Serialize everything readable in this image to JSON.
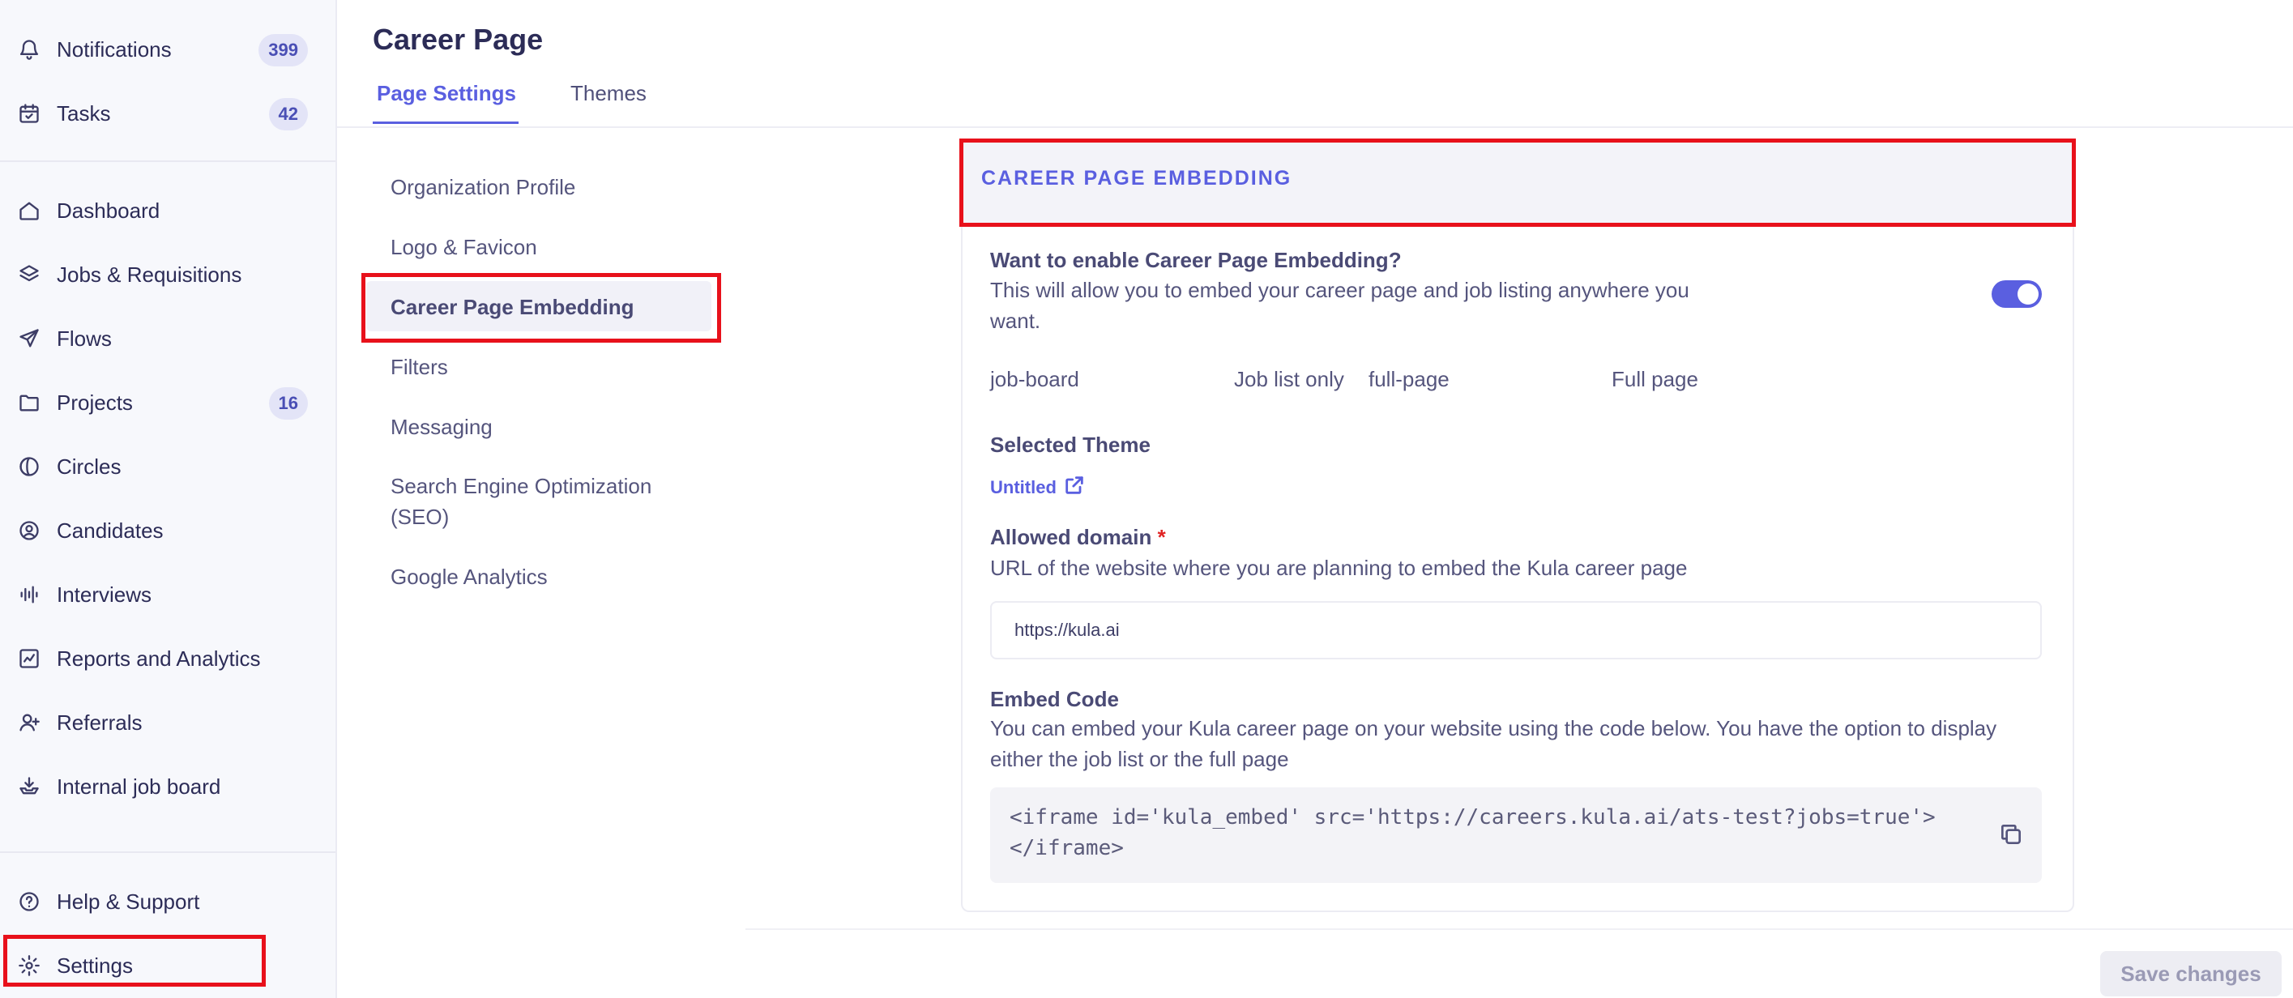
{
  "sidebar": {
    "top_items": [
      {
        "label": "Notifications",
        "icon": "bell-icon",
        "badge": "399"
      },
      {
        "label": "Tasks",
        "icon": "calendar-check-icon",
        "badge": "42"
      }
    ],
    "main_items": [
      {
        "label": "Dashboard",
        "icon": "home-icon"
      },
      {
        "label": "Jobs & Requisitions",
        "icon": "layers-icon"
      },
      {
        "label": "Flows",
        "icon": "send-icon"
      },
      {
        "label": "Projects",
        "icon": "folder-icon",
        "badge": "16"
      },
      {
        "label": "Circles",
        "icon": "circle-half-icon"
      },
      {
        "label": "Candidates",
        "icon": "user-circle-icon"
      },
      {
        "label": "Interviews",
        "icon": "audio-wave-icon"
      },
      {
        "label": "Reports and Analytics",
        "icon": "chart-icon"
      },
      {
        "label": "Referrals",
        "icon": "user-plus-icon"
      },
      {
        "label": "Internal job board",
        "icon": "inbox-stack-icon"
      }
    ],
    "bottom_items": [
      {
        "label": "Help & Support",
        "icon": "question-circle-icon"
      },
      {
        "label": "Settings",
        "icon": "gear-icon",
        "active": true
      }
    ]
  },
  "header": {
    "title": "Career Page",
    "tabs": [
      {
        "label": "Page Settings",
        "active": true
      },
      {
        "label": "Themes",
        "active": false
      }
    ]
  },
  "submenu": {
    "items": [
      {
        "label": "Organization Profile"
      },
      {
        "label": "Logo & Favicon"
      },
      {
        "label": "Career Page Embedding",
        "active": true
      },
      {
        "label": "Filters"
      },
      {
        "label": "Messaging"
      },
      {
        "label": "Search Engine Optimization (SEO)"
      },
      {
        "label": "Google Analytics"
      }
    ]
  },
  "embedding": {
    "section_title": "CAREER PAGE EMBEDDING",
    "enable_title": "Want to enable Career Page Embedding?",
    "enable_description": "This will allow you to embed your career page and job listing anywhere you want.",
    "enabled": true,
    "options": [
      {
        "value": "job-board",
        "label": "Job list only"
      },
      {
        "value": "full-page",
        "label": "Full page"
      }
    ],
    "selected_theme_label": "Selected Theme",
    "selected_theme": "Untitled",
    "allowed_domain_label": "Allowed domain",
    "required_mark": "*",
    "allowed_domain_description": "URL of the website where you are planning to embed the Kula career page",
    "allowed_domain_value": "https://kula.ai",
    "embed_code_label": "Embed Code",
    "embed_code_description": "You can embed your Kula career page on your website using the code below. You have the option to display either the job list or the full page",
    "embed_code_line1": "<iframe id='kula_embed' src='https://careers.kula.ai/ats-test?jobs=true'>",
    "embed_code_line2": "</iframe>"
  },
  "footer": {
    "save_label": "Save changes"
  },
  "colors": {
    "accent": "#5a5fe0",
    "highlight": "#e8111b",
    "badge_bg": "#e3e4f7"
  }
}
